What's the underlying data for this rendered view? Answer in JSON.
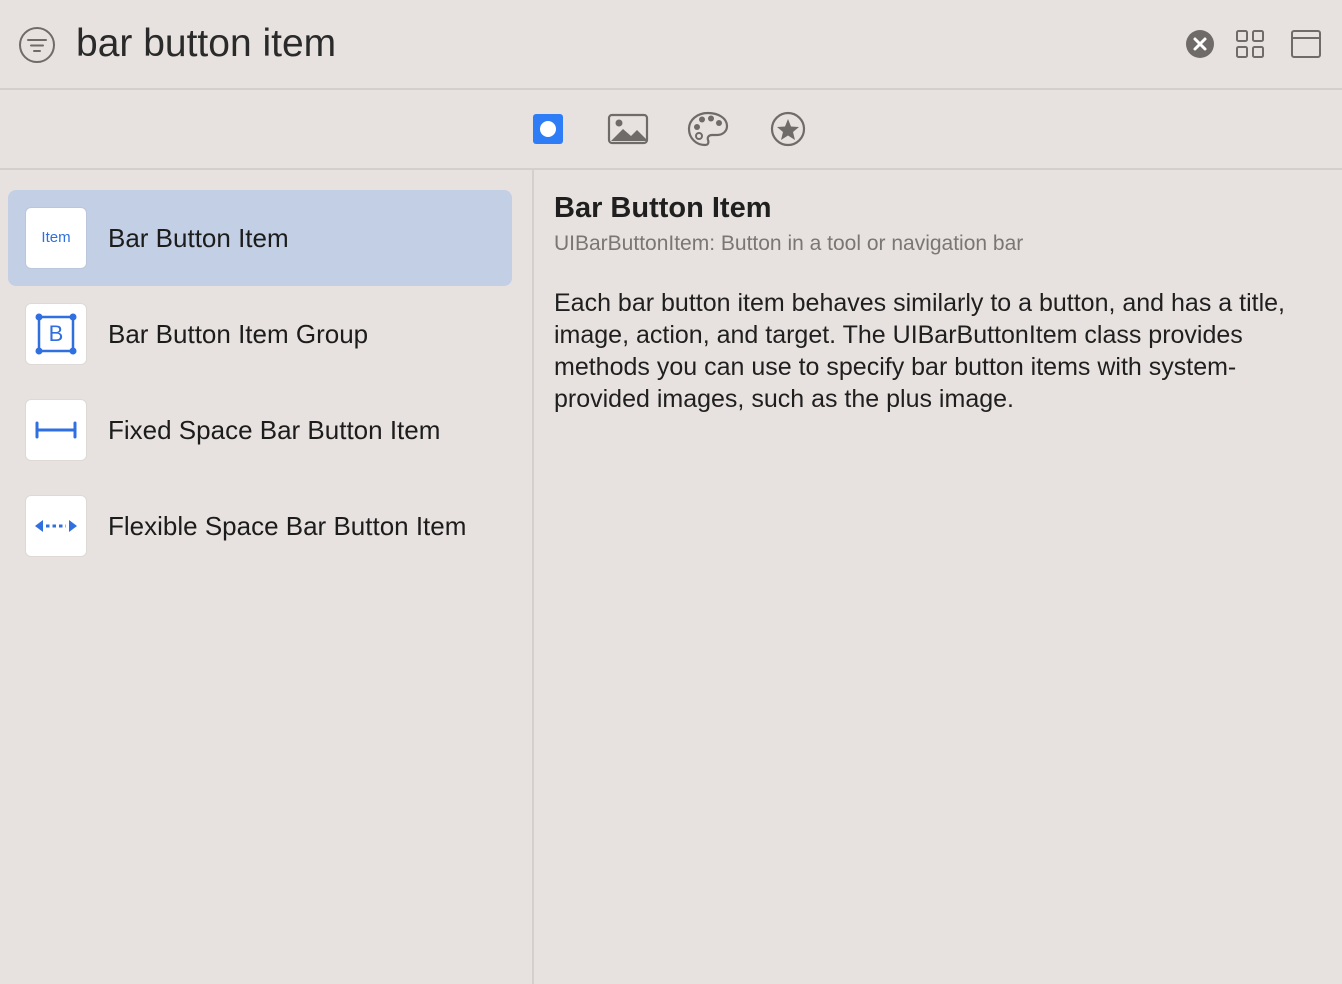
{
  "search": {
    "query": "bar button item",
    "filter_icon": "filter-icon",
    "clear_icon": "clear-circle-x-icon"
  },
  "toolbar": {
    "grid_icon": "grid-view-icon",
    "window_icon": "window-panel-icon"
  },
  "tabs": [
    {
      "icon": "objects-icon",
      "selected": true
    },
    {
      "icon": "image-icon",
      "selected": false
    },
    {
      "icon": "palette-icon",
      "selected": false
    },
    {
      "icon": "star-circle-icon",
      "selected": false
    }
  ],
  "items": [
    {
      "label": "Bar Button Item",
      "icon_text": "Item",
      "icon": "item-text-icon",
      "selected": true
    },
    {
      "label": "Bar Button Item Group",
      "icon": "bordered-b-icon",
      "icon_text": "B",
      "selected": false
    },
    {
      "label": "Fixed Space Bar Button Item",
      "icon": "fixed-space-icon",
      "selected": false
    },
    {
      "label": "Flexible Space Bar Button Item",
      "icon": "flexible-space-icon",
      "selected": false
    }
  ],
  "detail": {
    "title": "Bar Button Item",
    "subtitle": "UIBarButtonItem: Button in a tool or navigation bar",
    "description": "Each bar button item behaves similarly to a button, and has a title, image, action, and target. The UIBarButtonItem class provides methods you can use to specify bar button items with system-provided images, such as the plus image."
  },
  "colors": {
    "background": "#e7e2df",
    "selection": "#c3cfe5",
    "accent": "#2f6fe0",
    "icon_gray": "#6f6b69"
  }
}
